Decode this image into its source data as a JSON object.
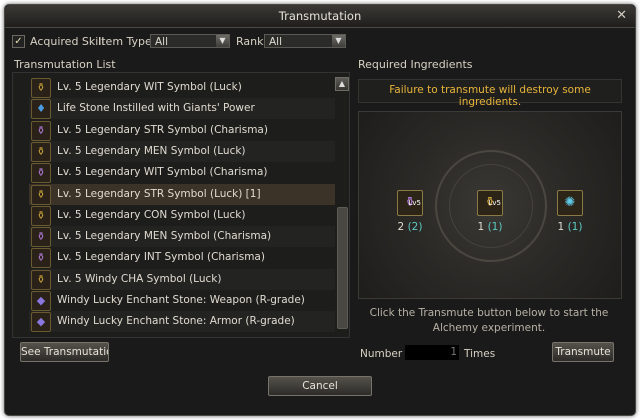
{
  "window": {
    "title": "Transmutation",
    "close_glyph": "✕"
  },
  "filters": {
    "acquired_skill": {
      "label": "Acquired Skill",
      "checked": true,
      "check_glyph": "✓"
    },
    "item_type": {
      "label": "Item Type",
      "value": "All"
    },
    "rank": {
      "label": "Rank",
      "value": "All"
    }
  },
  "list": {
    "title": "Transmutation List",
    "items": [
      {
        "label": "Lv. 5 Legendary WIT Symbol (Luck)",
        "icon": "symbol-icon",
        "glyph": "⚱",
        "color": "#c8a23a"
      },
      {
        "label": "Life Stone Instilled with Giants' Power",
        "icon": "life-stone-icon",
        "glyph": "♦",
        "color": "#4a9be0"
      },
      {
        "label": "Lv. 5 Legendary STR Symbol (Charisma)",
        "icon": "symbol-icon",
        "glyph": "⚱",
        "color": "#b07ad8"
      },
      {
        "label": "Lv. 5 Legendary MEN Symbol (Luck)",
        "icon": "symbol-icon",
        "glyph": "⚱",
        "color": "#c8a23a"
      },
      {
        "label": "Lv. 5 Legendary WIT Symbol (Charisma)",
        "icon": "symbol-icon",
        "glyph": "⚱",
        "color": "#b07ad8"
      },
      {
        "label": "Lv. 5 Legendary STR Symbol (Luck) [1]",
        "icon": "symbol-icon",
        "glyph": "⚱",
        "color": "#c8a23a"
      },
      {
        "label": "Lv. 5 Legendary CON Symbol (Luck)",
        "icon": "symbol-icon",
        "glyph": "⚱",
        "color": "#c8a23a"
      },
      {
        "label": "Lv. 5 Legendary MEN Symbol (Charisma)",
        "icon": "symbol-icon",
        "glyph": "⚱",
        "color": "#b07ad8"
      },
      {
        "label": "Lv. 5 Legendary INT Symbol (Charisma)",
        "icon": "symbol-icon",
        "glyph": "⚱",
        "color": "#b07ad8"
      },
      {
        "label": "Lv. 5 Windy CHA Symbol (Luck)",
        "icon": "symbol-icon",
        "glyph": "⚱",
        "color": "#c8a23a"
      },
      {
        "label": "Windy Lucky Enchant Stone: Weapon (R-grade)",
        "icon": "enchant-stone-icon",
        "glyph": "◆",
        "color": "#8a78e0"
      },
      {
        "label": "Windy Lucky Enchant Stone: Armor (R-grade)",
        "icon": "enchant-stone-icon",
        "glyph": "◆",
        "color": "#8a78e0"
      }
    ],
    "selected_index": 5,
    "scroll_up_glyph": "▲"
  },
  "see_transmutation_button": "See Transmutation",
  "ingredients": {
    "title": "Required Ingredients",
    "warning": "Failure to transmute will destroy some ingredients.",
    "items": [
      {
        "icon": "symbol-icon",
        "glyph": "⚱",
        "color": "#b07ad8",
        "level": "Lv5",
        "required": "2",
        "have": "(2)"
      },
      {
        "icon": "symbol-icon",
        "glyph": "⚱",
        "color": "#c8a23a",
        "level": "Lv5",
        "required": "1",
        "have": "(1)"
      },
      {
        "icon": "gem-icon",
        "glyph": "✺",
        "color": "#5fc9e8",
        "level": "",
        "required": "1",
        "have": "(1)"
      }
    ],
    "hint": "Click the Transmute button below to start the Alchemy experiment.",
    "number_label": "Number of",
    "number_value": "1",
    "times_label": "Times",
    "transmute_button": "Transmute"
  },
  "cancel_button": "Cancel"
}
